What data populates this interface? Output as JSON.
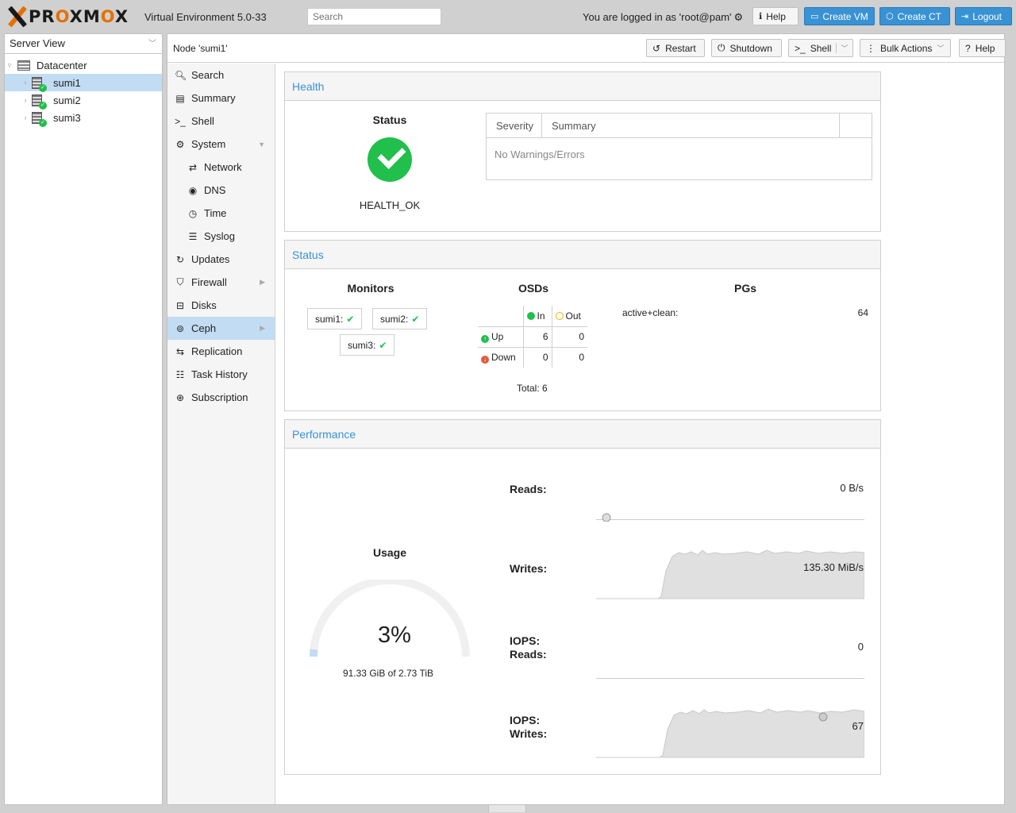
{
  "header": {
    "logo_text_pre": "PR",
    "logo_text_o1": "O",
    "logo_text_mid": "XM",
    "logo_text_o2": "O",
    "logo_text_post": "X",
    "version": "Virtual Environment 5.0-33",
    "search_placeholder": "Search",
    "login_text": "You are logged in as 'root@pam'",
    "help_label": "Help",
    "create_vm_label": "Create VM",
    "create_ct_label": "Create CT",
    "logout_label": "Logout"
  },
  "tree": {
    "view": "Server View",
    "datacenter": "Datacenter",
    "nodes": [
      {
        "name": "sumi1",
        "selected": true
      },
      {
        "name": "sumi2",
        "selected": false
      },
      {
        "name": "sumi3",
        "selected": false
      }
    ]
  },
  "node_header": {
    "title": "Node 'sumi1'",
    "restart": "Restart",
    "shutdown": "Shutdown",
    "shell": "Shell",
    "bulk_actions": "Bulk Actions",
    "help": "Help"
  },
  "nav": {
    "items": [
      {
        "label": "Search",
        "icon": "search-icon"
      },
      {
        "label": "Summary",
        "icon": "book-icon"
      },
      {
        "label": "Shell",
        "icon": "terminal-icon"
      },
      {
        "label": "System",
        "icon": "cogs-icon"
      },
      {
        "label": "Network",
        "icon": "exchange-icon"
      },
      {
        "label": "DNS",
        "icon": "globe-icon"
      },
      {
        "label": "Time",
        "icon": "clock-icon"
      },
      {
        "label": "Syslog",
        "icon": "list-icon"
      },
      {
        "label": "Updates",
        "icon": "refresh-icon"
      },
      {
        "label": "Firewall",
        "icon": "shield-icon"
      },
      {
        "label": "Disks",
        "icon": "hdd-icon"
      },
      {
        "label": "Ceph",
        "icon": "ceph-icon"
      },
      {
        "label": "Replication",
        "icon": "retweet-icon"
      },
      {
        "label": "Task History",
        "icon": "list-alt-icon"
      },
      {
        "label": "Subscription",
        "icon": "support-icon"
      }
    ]
  },
  "health": {
    "title": "Health",
    "status_label": "Status",
    "status_value": "HEALTH_OK",
    "col_severity": "Severity",
    "col_summary": "Summary",
    "empty_text": "No Warnings/Errors"
  },
  "status": {
    "title": "Status",
    "monitors_title": "Monitors",
    "monitors": [
      "sumi1:",
      "sumi2:",
      "sumi3:"
    ],
    "osds_title": "OSDs",
    "osd_in": "In",
    "osd_out": "Out",
    "osd_up": "Up",
    "osd_down": "Down",
    "up_in": "6",
    "up_out": "0",
    "down_in": "0",
    "down_out": "0",
    "total": "Total: 6",
    "pgs_title": "PGs",
    "pg_state": "active+clean:",
    "pg_count": "64"
  },
  "performance": {
    "title": "Performance",
    "usage_title": "Usage",
    "usage_percent": "3%",
    "usage_fraction": 0.03,
    "usage_text": "91.33 GiB of 2.73 TiB",
    "reads_label": "Reads:",
    "reads_value": "0 B/s",
    "writes_label": "Writes:",
    "writes_value": "135.30 MiB/s",
    "iops_reads_label1": "IOPS:",
    "iops_reads_label2": "Reads:",
    "iops_reads_value": "0",
    "iops_writes_label1": "IOPS:",
    "iops_writes_label2": "Writes:",
    "iops_writes_value": "67"
  },
  "colors": {
    "accent": "#3892d4",
    "ok_green": "#21bf4b",
    "brand_orange": "#e57000",
    "selection": "#c2dcf3"
  }
}
